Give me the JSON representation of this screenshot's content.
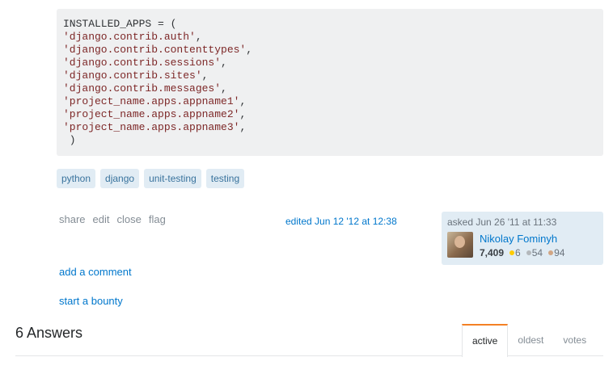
{
  "code": {
    "lines": [
      {
        "text": "INSTALLED_APPS = (",
        "kind": "plain"
      },
      {
        "text": "'django.contrib.auth'",
        "kind": "str",
        "tail": ","
      },
      {
        "text": "'django.contrib.contenttypes'",
        "kind": "str",
        "tail": ","
      },
      {
        "text": "'django.contrib.sessions'",
        "kind": "str",
        "tail": ","
      },
      {
        "text": "'django.contrib.sites'",
        "kind": "str",
        "tail": ","
      },
      {
        "text": "'django.contrib.messages'",
        "kind": "str",
        "tail": ","
      },
      {
        "text": "'project_name.apps.appname1'",
        "kind": "str",
        "tail": ","
      },
      {
        "text": "'project_name.apps.appname2'",
        "kind": "str",
        "tail": ","
      },
      {
        "text": "'project_name.apps.appname3'",
        "kind": "str",
        "tail": ","
      },
      {
        "text": " )",
        "kind": "plain"
      }
    ]
  },
  "tags": [
    "python",
    "django",
    "unit-testing",
    "testing"
  ],
  "post_menu": {
    "share": "share",
    "edit": "edit",
    "close": "close",
    "flag": "flag"
  },
  "edited": "edited Jun 12 '12 at 12:38",
  "owner": {
    "asked": "asked Jun 26 '11 at 11:33",
    "name": "Nikolay Fominyh",
    "reputation": "7,409",
    "gold": "6",
    "silver": "54",
    "bronze": "94",
    "colors": {
      "gold": "#ffcc01",
      "silver": "#b4b8bc",
      "bronze": "#d1a684"
    }
  },
  "links": {
    "add_comment": "add a comment",
    "start_bounty": "start a bounty"
  },
  "answers": {
    "title": "6 Answers",
    "tabs": [
      "active",
      "oldest",
      "votes"
    ],
    "accent": "#f48024"
  }
}
